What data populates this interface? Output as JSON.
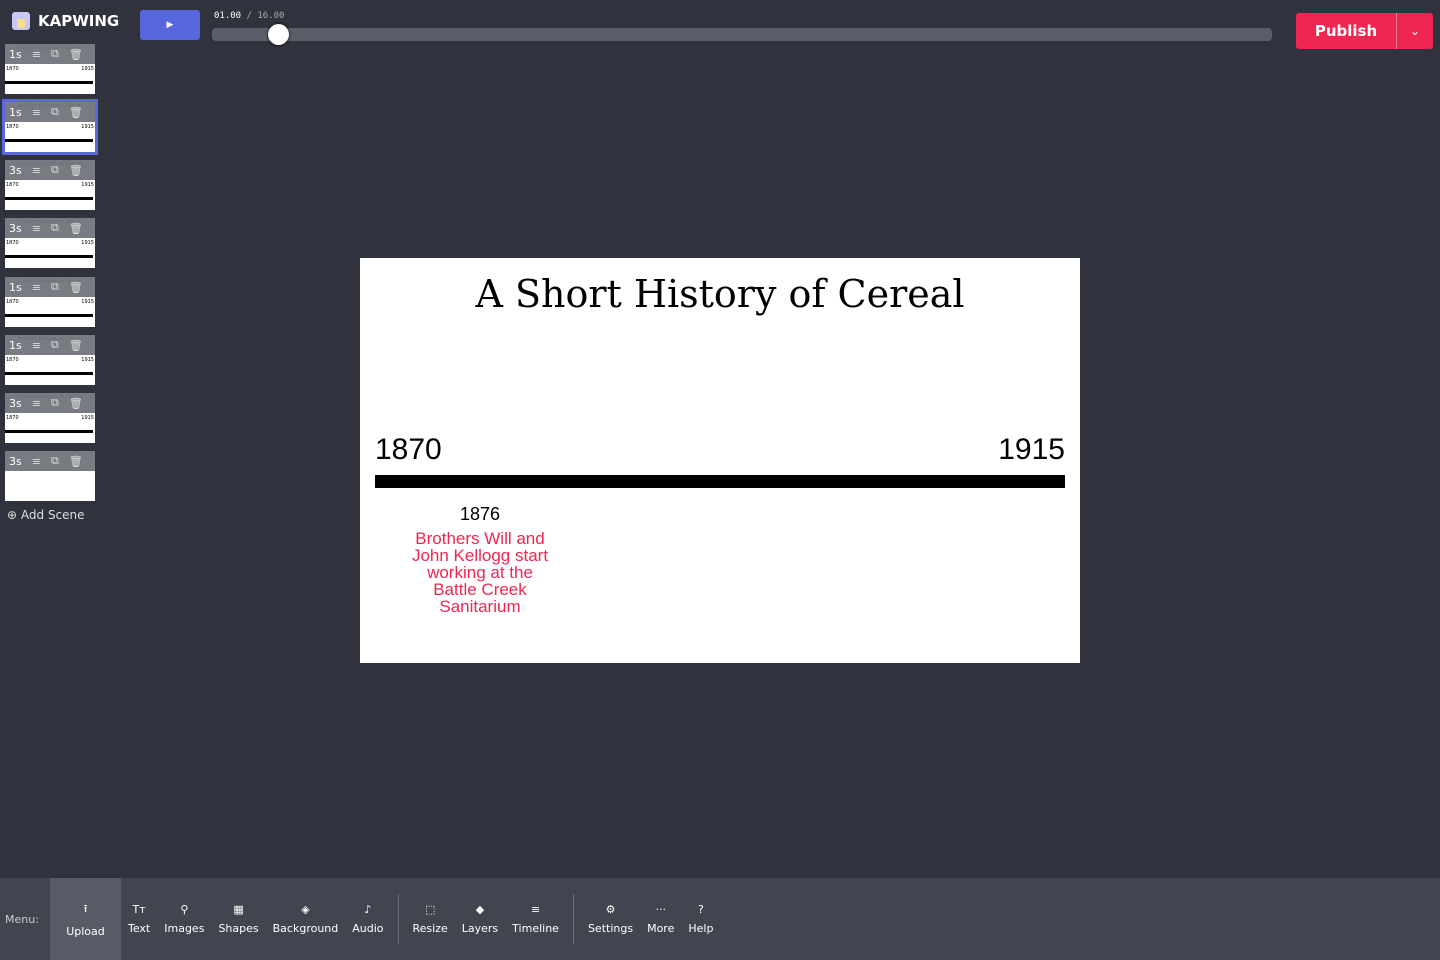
{
  "app": {
    "name": "KAPWING"
  },
  "player": {
    "current": "01.00",
    "separator": "/",
    "total": "16.00",
    "progress": 0.0625
  },
  "publish": {
    "label": "Publish"
  },
  "scenes": [
    {
      "duration": "1s"
    },
    {
      "duration": "1s",
      "selected": true
    },
    {
      "duration": "3s"
    },
    {
      "duration": "3s"
    },
    {
      "duration": "1s"
    },
    {
      "duration": "1s"
    },
    {
      "duration": "3s"
    },
    {
      "duration": "3s"
    }
  ],
  "add_scene": "Add Scene",
  "canvas": {
    "title": "A Short History of Cereal",
    "start_year": "1870",
    "end_year": "1915",
    "event_year": "1876",
    "event_text": "Brothers Will and John Kellogg start working at the Battle Creek Sanitarium",
    "event_color": "#ef2651"
  },
  "menu": {
    "label": "Menu:",
    "items": [
      "Upload",
      "Text",
      "Images",
      "Shapes",
      "Background",
      "Audio",
      "Resize",
      "Layers",
      "Timeline",
      "Settings",
      "More",
      "Help"
    ]
  },
  "colors": {
    "accent": "#5867dd",
    "publish": "#ef2651",
    "bg": "#30333d"
  }
}
